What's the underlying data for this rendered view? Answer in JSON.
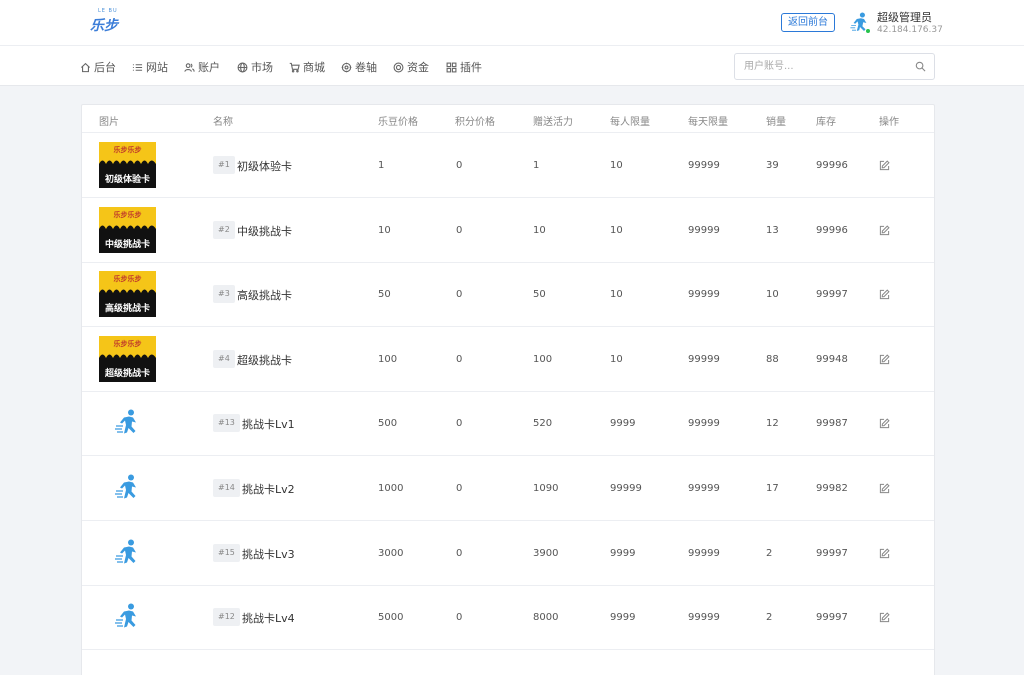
{
  "header": {
    "logo_small": "LE BU",
    "logo_main": "乐步",
    "back_label": "返回前台",
    "user_name": "超级管理员",
    "user_ip": "42.184.176.37"
  },
  "nav": {
    "items": [
      {
        "label": "后台",
        "icon": "home-icon"
      },
      {
        "label": "网站",
        "icon": "list-icon"
      },
      {
        "label": "账户",
        "icon": "users-icon"
      },
      {
        "label": "市场",
        "icon": "globe-icon"
      },
      {
        "label": "商城",
        "icon": "cart-icon"
      },
      {
        "label": "卷轴",
        "icon": "scroll-icon"
      },
      {
        "label": "资金",
        "icon": "coin-icon"
      },
      {
        "label": "插件",
        "icon": "grid-icon"
      }
    ]
  },
  "search": {
    "placeholder": "用户账号...",
    "value": ""
  },
  "table": {
    "headers": [
      "图片",
      "名称",
      "乐豆价格",
      "积分价格",
      "赠送活力",
      "每人限量",
      "每天限量",
      "销量",
      "库存",
      "操作"
    ],
    "rows": [
      {
        "img": "card",
        "card_top": "乐步乐步",
        "card_label": "初级体验卡",
        "id": "#1",
        "name": "初级体验卡",
        "bean_price": "1",
        "point_price": "0",
        "vitality": "1",
        "per_person": "10",
        "per_day": "99999",
        "sales": "39",
        "stock": "99996"
      },
      {
        "img": "card",
        "card_top": "乐步乐步",
        "card_label": "中级挑战卡",
        "id": "#2",
        "name": "中级挑战卡",
        "bean_price": "10",
        "point_price": "0",
        "vitality": "10",
        "per_person": "10",
        "per_day": "99999",
        "sales": "13",
        "stock": "99996"
      },
      {
        "img": "card",
        "card_top": "乐步乐步",
        "card_label": "高级挑战卡",
        "id": "#3",
        "name": "高级挑战卡",
        "bean_price": "50",
        "point_price": "0",
        "vitality": "50",
        "per_person": "10",
        "per_day": "99999",
        "sales": "10",
        "stock": "99997"
      },
      {
        "img": "card",
        "card_top": "乐步乐步",
        "card_label": "超级挑战卡",
        "id": "#4",
        "name": "超级挑战卡",
        "bean_price": "100",
        "point_price": "0",
        "vitality": "100",
        "per_person": "10",
        "per_day": "99999",
        "sales": "88",
        "stock": "99948"
      },
      {
        "img": "runner",
        "id": "#13",
        "name": "挑战卡Lv1",
        "bean_price": "500",
        "point_price": "0",
        "vitality": "520",
        "per_person": "9999",
        "per_day": "99999",
        "sales": "12",
        "stock": "99987"
      },
      {
        "img": "runner",
        "id": "#14",
        "name": "挑战卡Lv2",
        "bean_price": "1000",
        "point_price": "0",
        "vitality": "1090",
        "per_person": "99999",
        "per_day": "99999",
        "sales": "17",
        "stock": "99982"
      },
      {
        "img": "runner",
        "id": "#15",
        "name": "挑战卡Lv3",
        "bean_price": "3000",
        "point_price": "0",
        "vitality": "3900",
        "per_person": "9999",
        "per_day": "99999",
        "sales": "2",
        "stock": "99997"
      },
      {
        "img": "runner",
        "id": "#12",
        "name": "挑战卡Lv4",
        "bean_price": "5000",
        "point_price": "0",
        "vitality": "8000",
        "per_person": "9999",
        "per_day": "99999",
        "sales": "2",
        "stock": "99997"
      }
    ]
  },
  "colors": {
    "accent": "#2b79d8",
    "card_yellow": "#f5c518",
    "runner_blue": "#3a9be0",
    "online_green": "#27c24c"
  }
}
